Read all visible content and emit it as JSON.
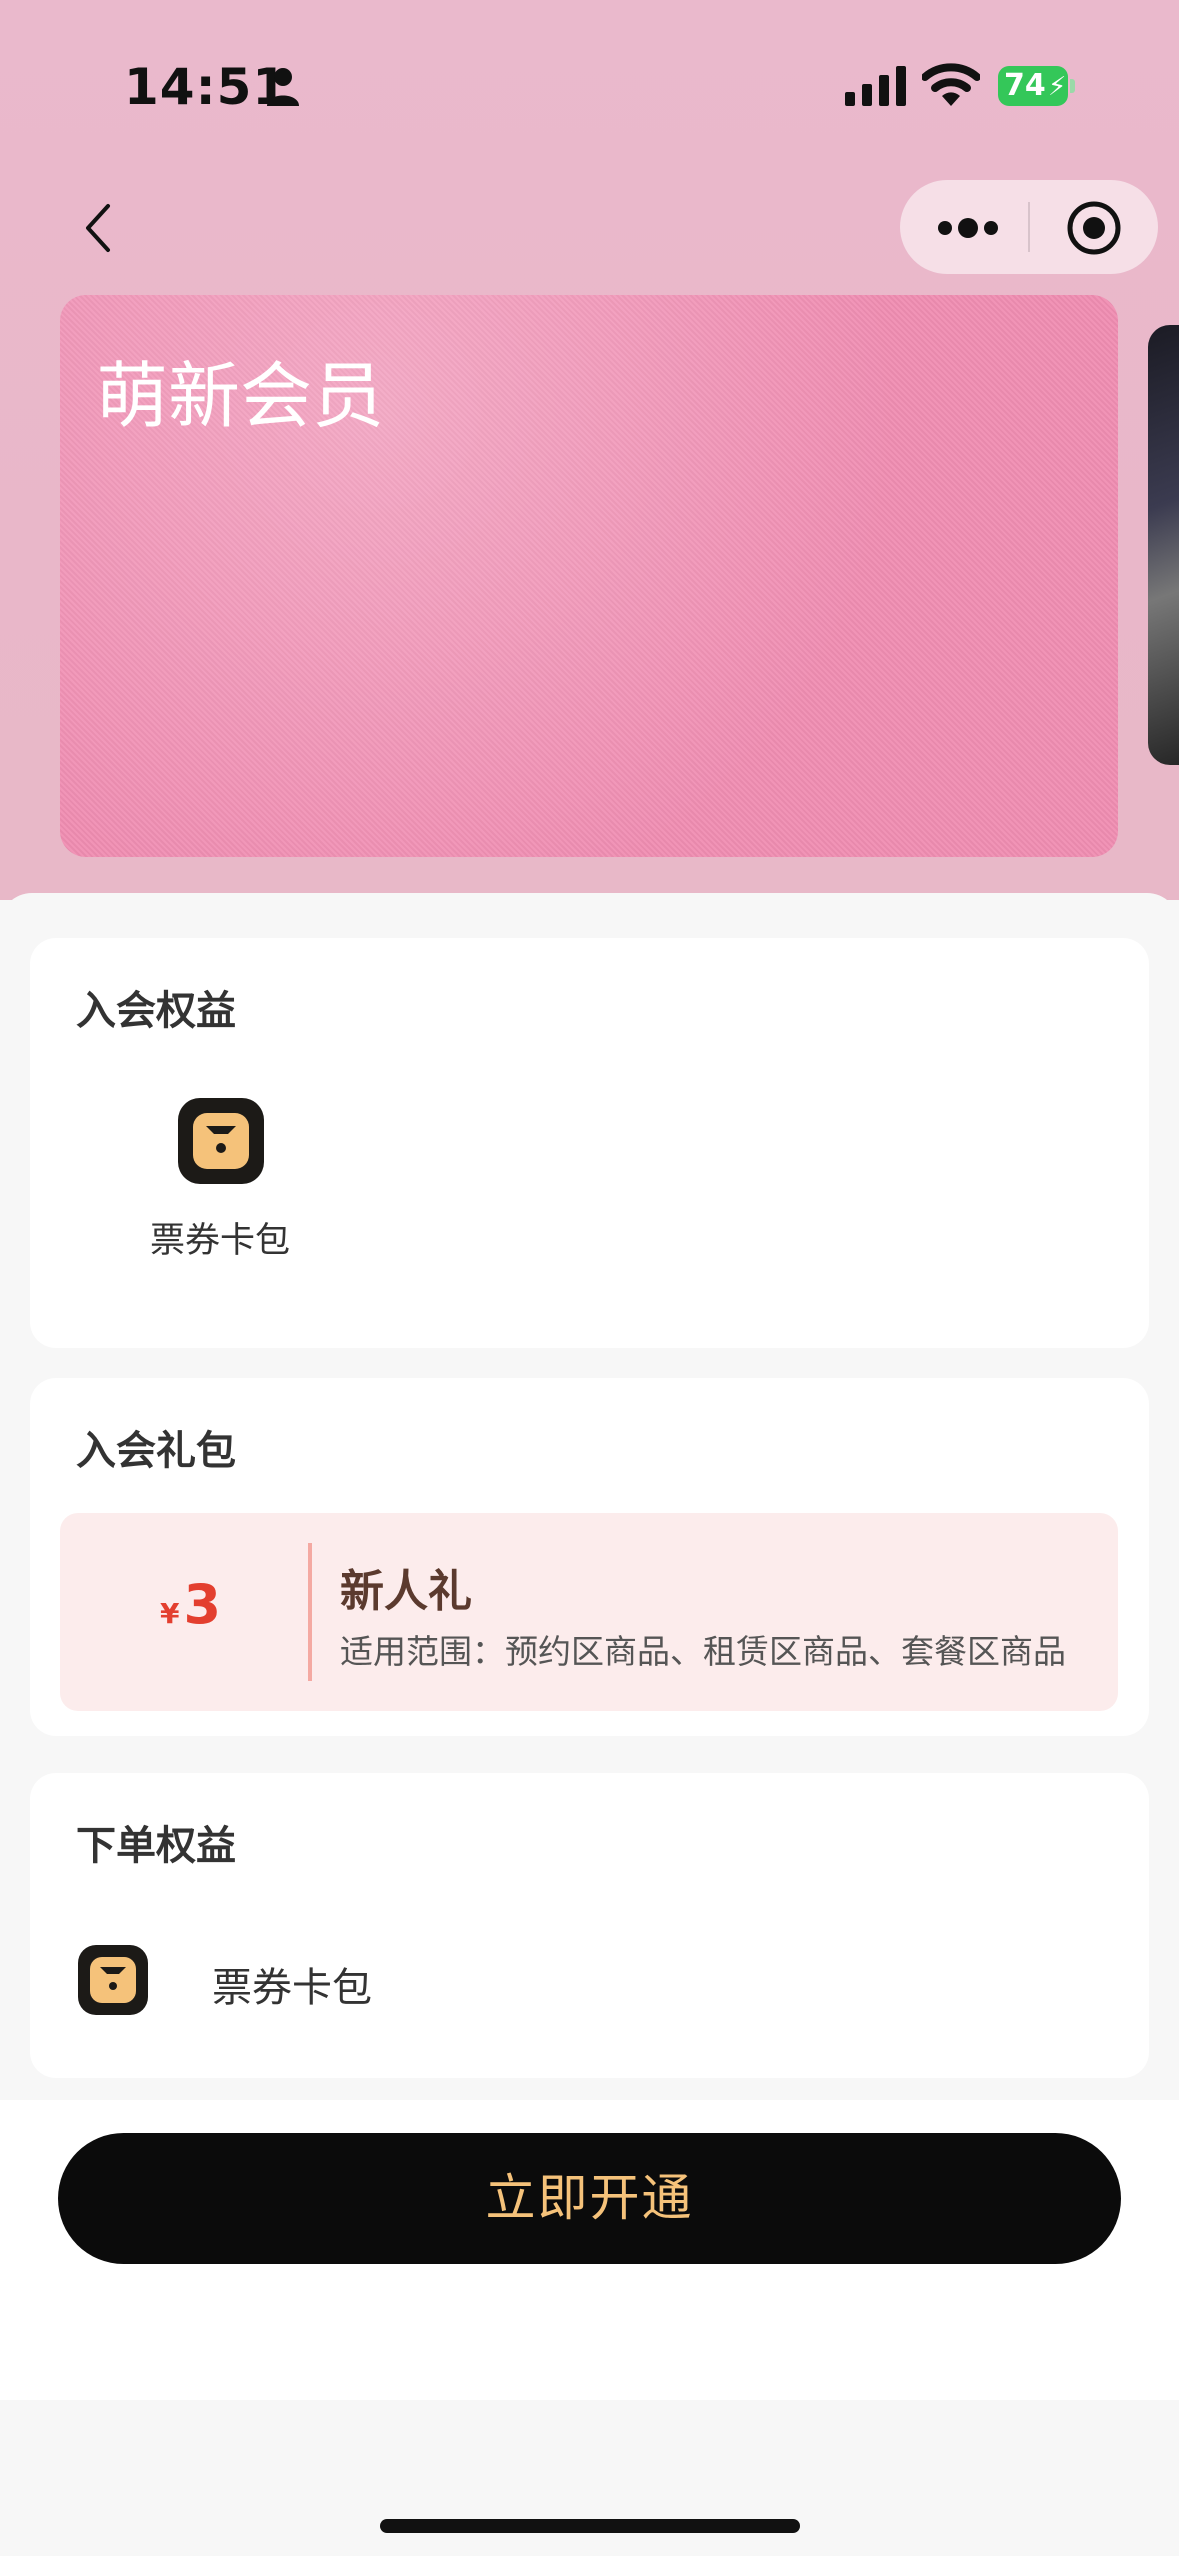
{
  "status_bar": {
    "time": "14:51",
    "battery": "74"
  },
  "header": {
    "back_icon": "chevron-left-icon",
    "more_icon": "more-dots-icon",
    "close_icon": "target-circle-icon"
  },
  "card": {
    "title": "萌新会员",
    "color": "#f08db2"
  },
  "sections": {
    "join_benefits": {
      "title": "入会权益",
      "items": [
        {
          "label": "票券卡包",
          "icon": "ticket-wallet-icon"
        }
      ]
    },
    "join_gift": {
      "title": "入会礼包",
      "coupon": {
        "currency": "¥",
        "amount": "3",
        "name": "新人礼",
        "scope": "适用范围：预约区商品、租赁区商品、套餐区商品"
      }
    },
    "order_benefits": {
      "title": "下单权益",
      "items": [
        {
          "label": "票券卡包",
          "icon": "ticket-wallet-icon"
        }
      ]
    }
  },
  "actions": {
    "open_now": "立即开通"
  },
  "colors": {
    "accent": "#f5c27a",
    "button_bg": "#0b0b0b",
    "coupon_red": "#e33f2f",
    "coupon_bg": "#fcecec"
  }
}
